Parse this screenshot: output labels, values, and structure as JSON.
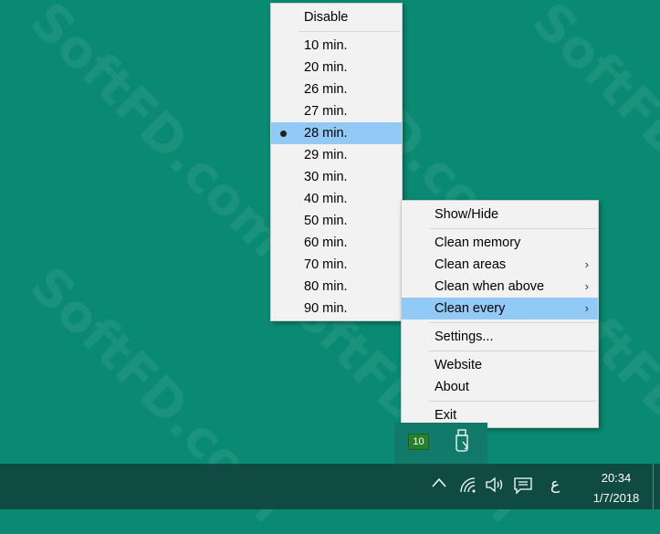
{
  "watermark": "SoftFD.com",
  "submenu": {
    "items": [
      {
        "label": "Disable"
      },
      {
        "label": "10 min."
      },
      {
        "label": "20 min."
      },
      {
        "label": "26 min."
      },
      {
        "label": "27 min."
      },
      {
        "label": "28 min.",
        "selected": true
      },
      {
        "label": "29 min."
      },
      {
        "label": "30 min."
      },
      {
        "label": "40 min."
      },
      {
        "label": "50 min."
      },
      {
        "label": "60 min."
      },
      {
        "label": "70 min."
      },
      {
        "label": "80 min."
      },
      {
        "label": "90 min."
      }
    ]
  },
  "mainmenu": {
    "show_hide": "Show/Hide",
    "clean_memory": "Clean memory",
    "clean_areas": "Clean areas",
    "clean_when_above": "Clean when above",
    "clean_every": "Clean every",
    "settings": "Settings...",
    "website": "Website",
    "about": "About",
    "exit": "Exit"
  },
  "tray": {
    "badge": "10",
    "lang": "ع",
    "time": "20:34",
    "date": "1/7/2018"
  },
  "colors": {
    "desktop": "#0a8a72",
    "taskbar": "#0f4b43",
    "menu_bg": "#f2f2f2",
    "highlight": "#91c9f7"
  }
}
